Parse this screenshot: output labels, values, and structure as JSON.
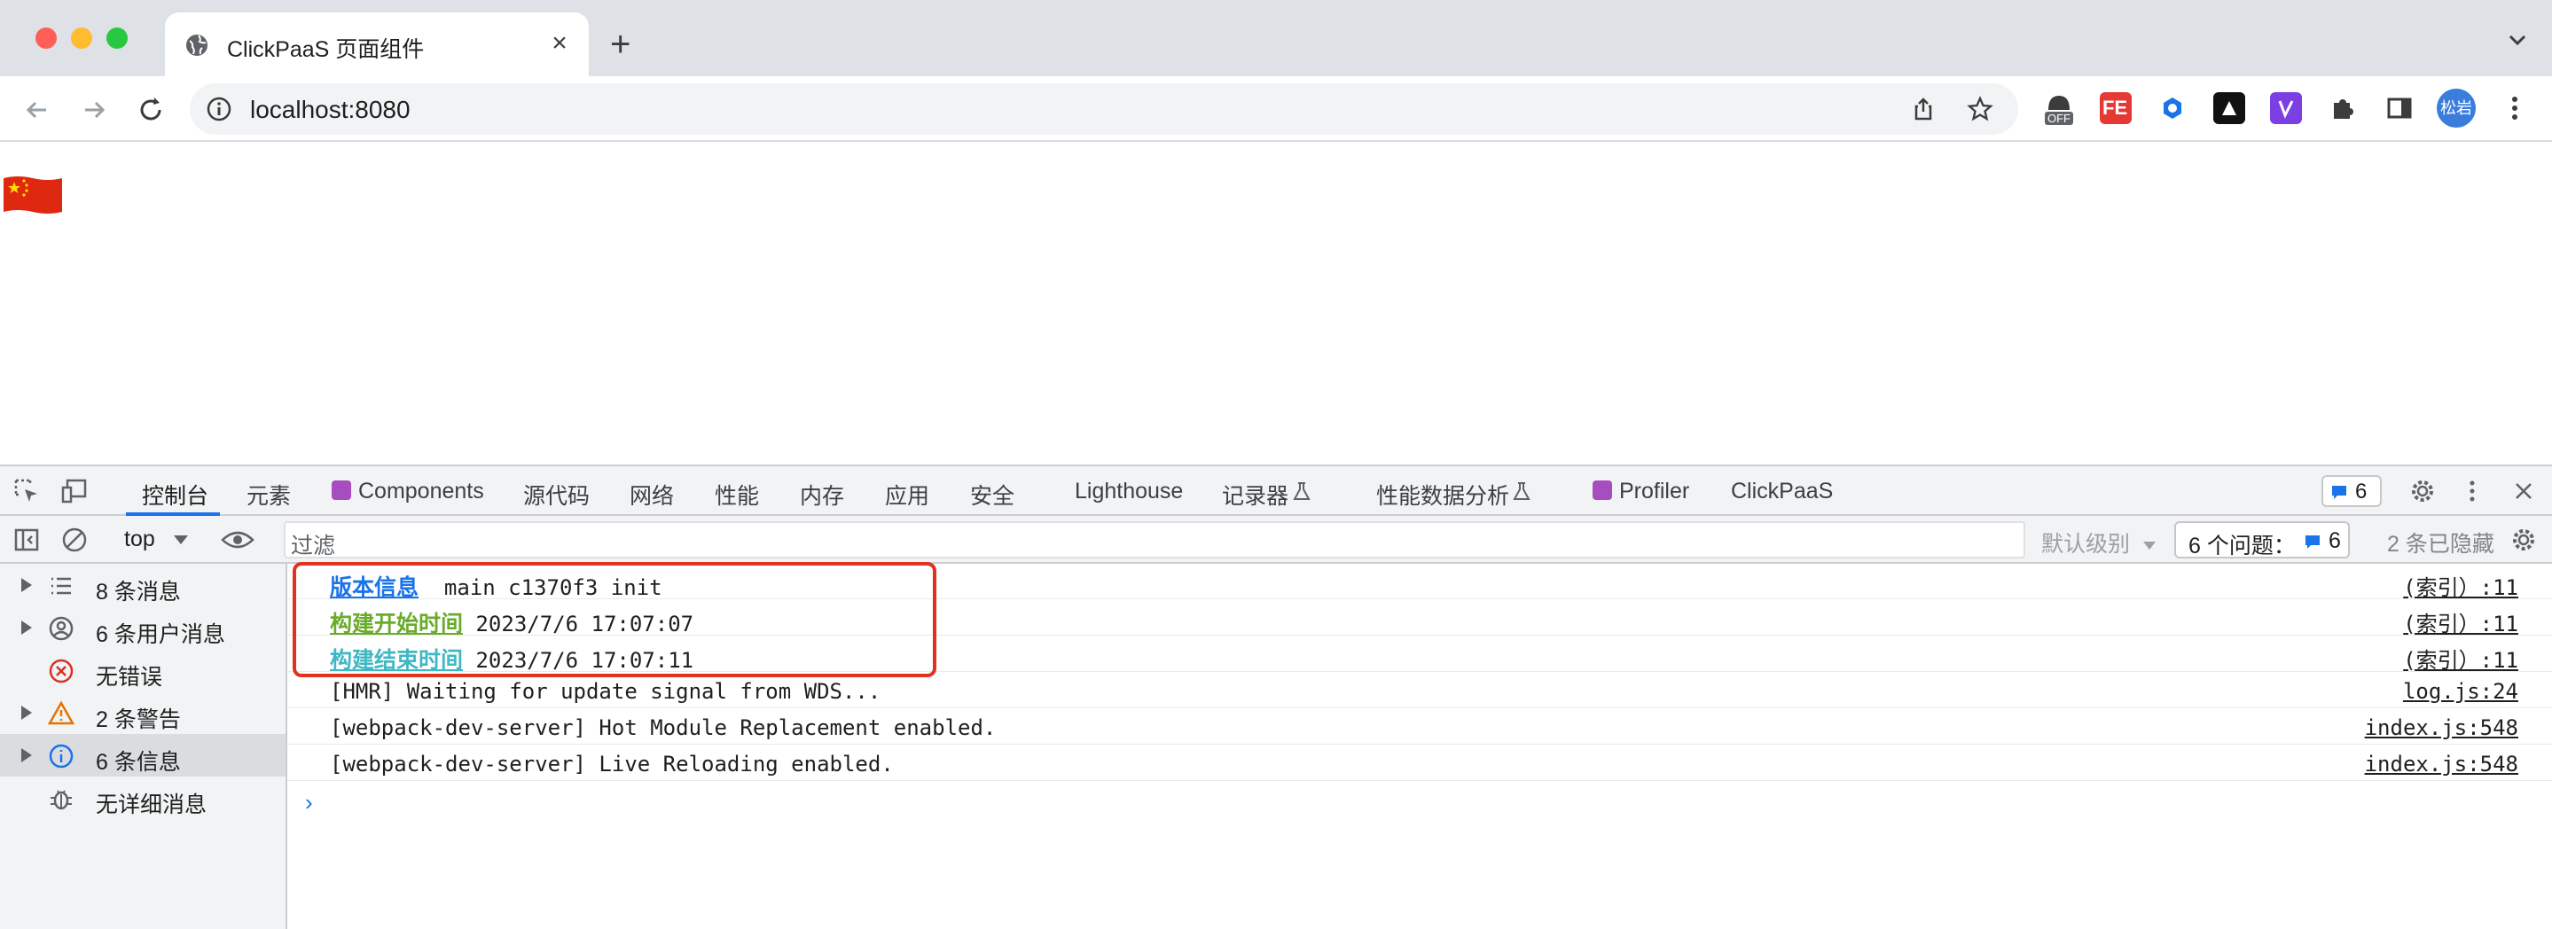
{
  "browser": {
    "tab_title": "ClickPaaS 页面组件",
    "tab_close": "×",
    "new_tab": "+",
    "url": "localhost:8080",
    "extension_badge": "OFF",
    "extension_fe": "FE",
    "profile_label": "松岩"
  },
  "devtools": {
    "tabs": [
      {
        "label": "控制台"
      },
      {
        "label": "元素"
      },
      {
        "label": "Components"
      },
      {
        "label": "源代码"
      },
      {
        "label": "网络"
      },
      {
        "label": "性能"
      },
      {
        "label": "内存"
      },
      {
        "label": "应用"
      },
      {
        "label": "安全"
      },
      {
        "label": "Lighthouse"
      },
      {
        "label": "记录器"
      },
      {
        "label": "性能数据分析"
      },
      {
        "label": "Profiler"
      },
      {
        "label": "ClickPaaS"
      }
    ],
    "issue_count": "6",
    "context": "top",
    "filter_placeholder": "过滤",
    "levels": "默认级别",
    "issues_label": "6 个问题：",
    "issues_count": "6",
    "hidden_count": "2 条已隐藏"
  },
  "sidebar": {
    "items": [
      {
        "label": "8 条消息"
      },
      {
        "label": "6 条用户消息"
      },
      {
        "label": "无错误"
      },
      {
        "label": "2 条警告"
      },
      {
        "label": "6 条信息"
      },
      {
        "label": "无详细消息"
      }
    ]
  },
  "console": {
    "rows": [
      {
        "tag": "版本信息",
        "text": "  main c1370f3 init",
        "source": "(索引）:11"
      },
      {
        "tag": "构建开始时间",
        "text": " 2023/7/6 17:07:07",
        "source": "(索引）:11"
      },
      {
        "tag": "构建结束时间",
        "text": " 2023/7/6 17:07:11",
        "source": "(索引）:11"
      },
      {
        "tag": "",
        "text": "[HMR] Waiting for update signal from WDS...",
        "source": "log.js:24"
      },
      {
        "tag": "",
        "text": "[webpack-dev-server] Hot Module Replacement enabled.",
        "source": "index.js:548"
      },
      {
        "tag": "",
        "text": "[webpack-dev-server] Live Reloading enabled.",
        "source": "index.js:548"
      }
    ],
    "prompt": "›"
  },
  "colors": {
    "tag_blue": "#1a73e8",
    "tag_green": "#6aab2b",
    "tag_teal": "#3fb8c4",
    "highlight": "#e0321f"
  }
}
